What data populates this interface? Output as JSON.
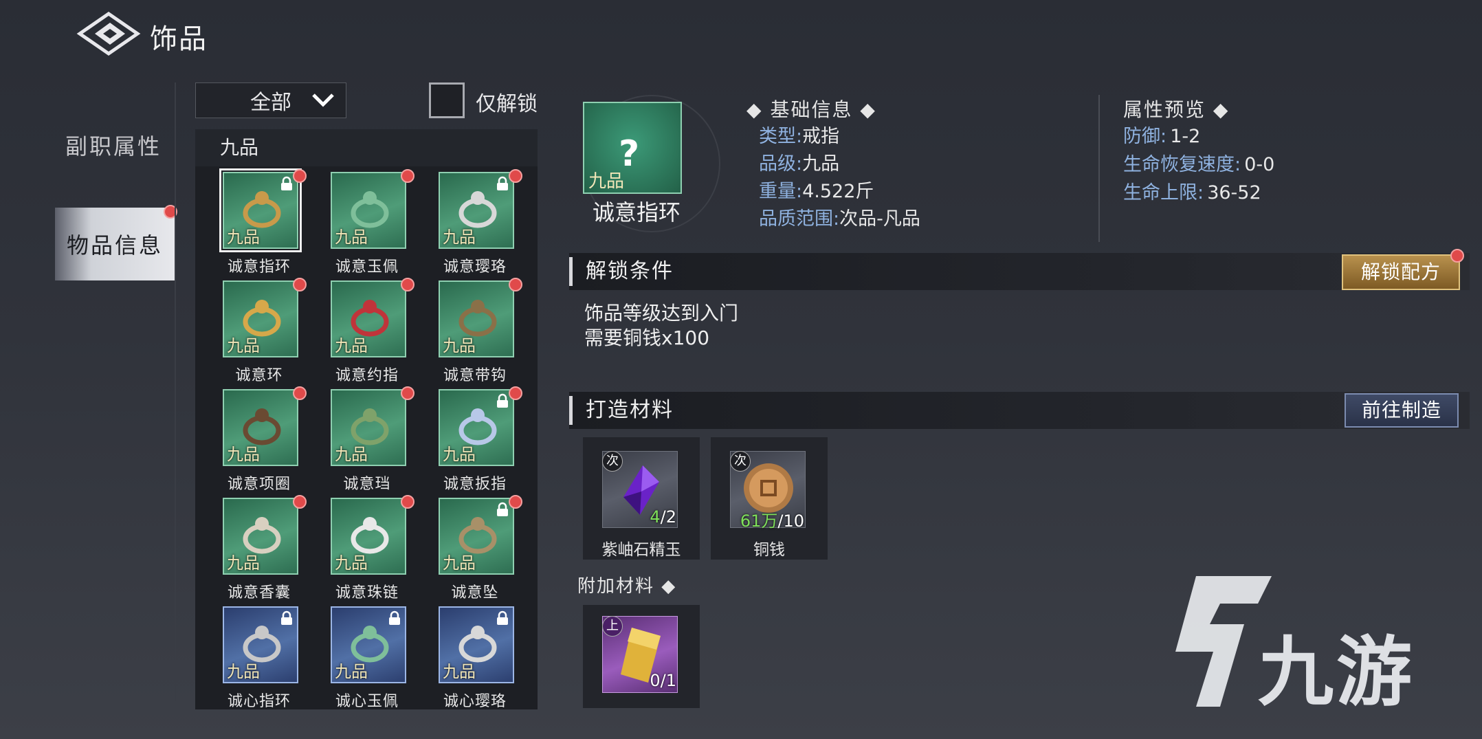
{
  "header": {
    "title": "饰品",
    "back_icon": "back-diamond-icon"
  },
  "side_nav": {
    "sub_tab": "副职属性",
    "active_tab": "物品信息"
  },
  "filter": {
    "dropdown_value": "全部",
    "checkbox_label": "仅解锁",
    "checkbox_checked": false
  },
  "item_list": {
    "grade_header": "九品",
    "items": [
      {
        "name": "诚意指环",
        "quality": "九品",
        "frame": "green",
        "locked": true,
        "new": true,
        "selected": true
      },
      {
        "name": "诚意玉佩",
        "quality": "九品",
        "frame": "green",
        "locked": false,
        "new": true
      },
      {
        "name": "诚意璎珞",
        "quality": "九品",
        "frame": "green",
        "locked": true,
        "new": true
      },
      {
        "name": "诚意环",
        "quality": "九品",
        "frame": "green",
        "locked": false,
        "new": true
      },
      {
        "name": "诚意约指",
        "quality": "九品",
        "frame": "green",
        "locked": false,
        "new": true
      },
      {
        "name": "诚意带钩",
        "quality": "九品",
        "frame": "green",
        "locked": false,
        "new": true
      },
      {
        "name": "诚意项圈",
        "quality": "九品",
        "frame": "green",
        "locked": false,
        "new": true
      },
      {
        "name": "诚意珰",
        "quality": "九品",
        "frame": "green",
        "locked": false,
        "new": true
      },
      {
        "name": "诚意扳指",
        "quality": "九品",
        "frame": "green",
        "locked": true,
        "new": true
      },
      {
        "name": "诚意香囊",
        "quality": "九品",
        "frame": "green",
        "locked": false,
        "new": true
      },
      {
        "name": "诚意珠链",
        "quality": "九品",
        "frame": "green",
        "locked": false,
        "new": true
      },
      {
        "name": "诚意坠",
        "quality": "九品",
        "frame": "green",
        "locked": true,
        "new": true
      },
      {
        "name": "诚心指环",
        "quality": "九品",
        "frame": "blue",
        "locked": true,
        "new": false
      },
      {
        "name": "诚心玉佩",
        "quality": "九品",
        "frame": "blue",
        "locked": true,
        "new": false
      },
      {
        "name": "诚心璎珞",
        "quality": "九品",
        "frame": "blue",
        "locked": true,
        "new": false
      }
    ]
  },
  "detail": {
    "selected_name": "诚意指环",
    "selected_quality": "九品",
    "selected_icon_mark": "?",
    "basic_title": "基础信息",
    "basic": {
      "type_label": "类型:",
      "type_value": "戒指",
      "grade_label": "品级:",
      "grade_value": "九品",
      "weight_label": "重量:",
      "weight_value": "4.522斤",
      "range_label": "品质范围:",
      "range_value": "次品-凡品"
    },
    "attr_title": "属性预览",
    "attrs": {
      "def_label": "防御:",
      "def_value": "1-2",
      "regen_label": "生命恢复速度:",
      "regen_value": "0-0",
      "hp_label": "生命上限:",
      "hp_value": "36-52"
    },
    "unlock_title": "解锁条件",
    "unlock_button": "解锁配方",
    "unlock_reqs": [
      "饰品等级达到入门",
      "需要铜钱x100"
    ],
    "craft_title": "打造材料",
    "craft_button": "前往制造",
    "materials": [
      {
        "name": "紫岫石精玉",
        "badge": "次",
        "have": "4",
        "need": "/2"
      },
      {
        "name": "铜钱",
        "badge": "次",
        "have": "61万",
        "need": "/10"
      }
    ],
    "extra_title": "附加材料",
    "extra_materials": [
      {
        "badge": "上",
        "count": "0/1"
      }
    ]
  },
  "watermark": {
    "text": "九游"
  },
  "colors": {
    "green_frame": "#4f9c78",
    "blue_frame": "#5170a6",
    "accent_gold": "#b8914d",
    "red_dot": "#e04a4a",
    "label_blue": "#8fb2e0"
  }
}
